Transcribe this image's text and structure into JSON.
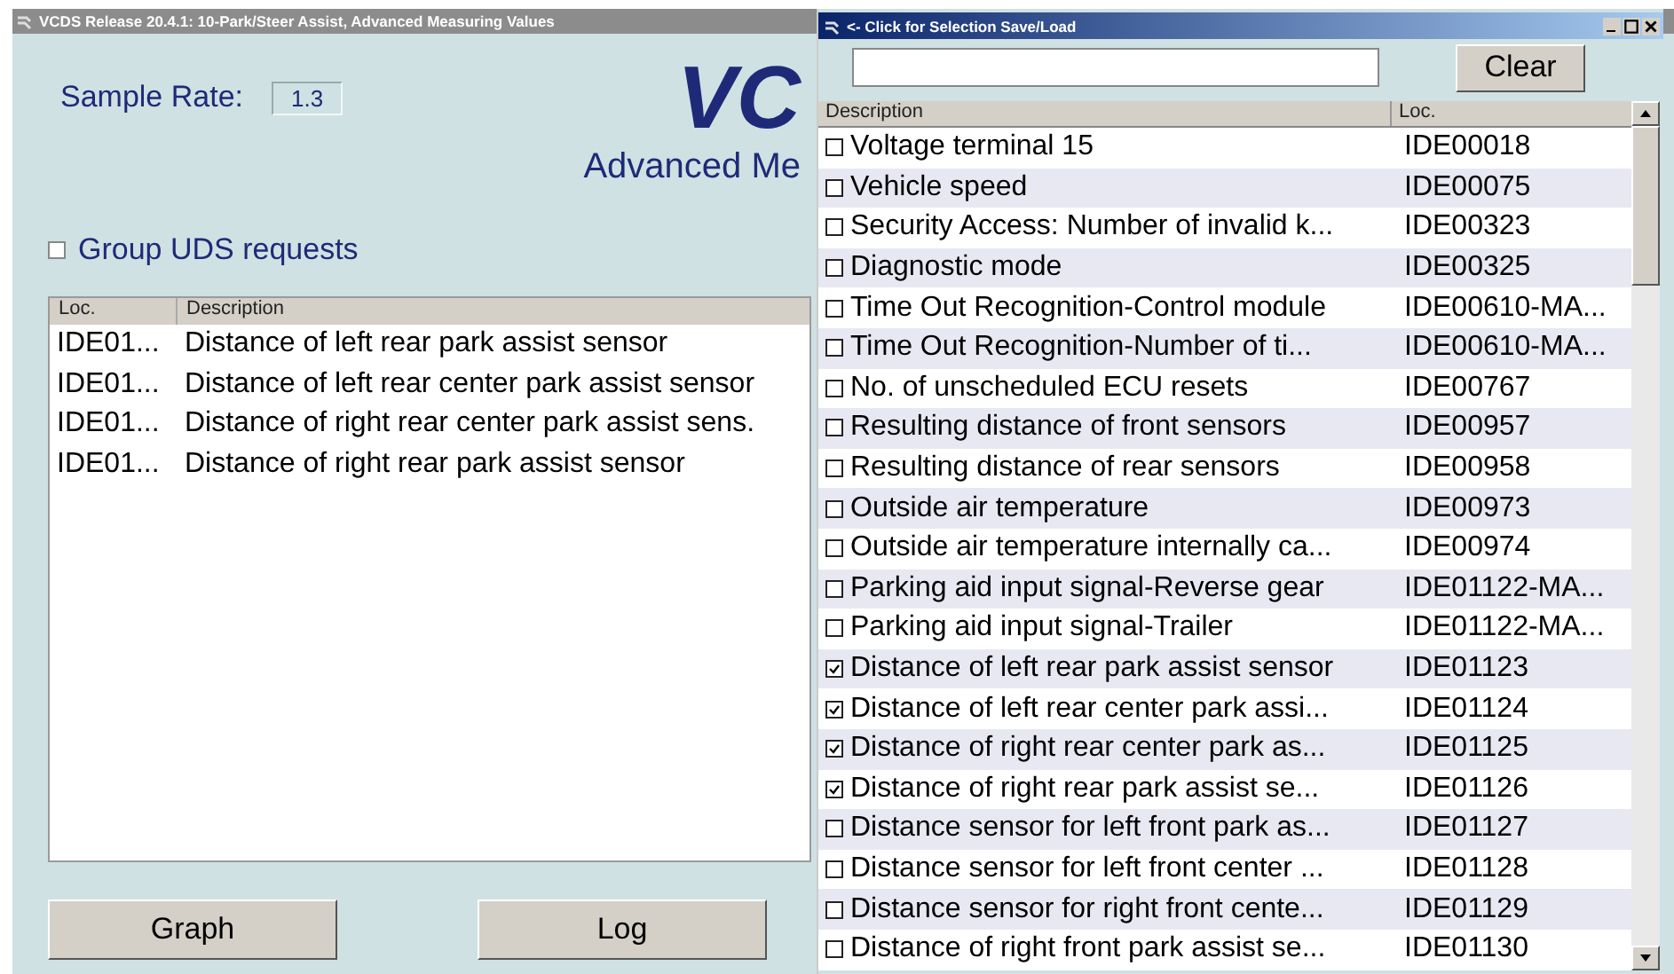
{
  "main_window": {
    "title": "VCDS Release 20.4.1: 10-Park/Steer Assist,  Advanced Measuring Values",
    "sample_rate": {
      "label": "Sample Rate:",
      "value": "1.3"
    },
    "logo": {
      "text": "VC",
      "subtitle": "Advanced Me"
    },
    "group_uds": {
      "label": "Group UDS requests",
      "checked": false
    },
    "list": {
      "columns": [
        "Loc.",
        "Description"
      ],
      "rows": [
        {
          "loc": "IDE01...",
          "description": "Distance of left rear park assist sensor"
        },
        {
          "loc": "IDE01...",
          "description": "Distance of left rear center park assist sensor"
        },
        {
          "loc": "IDE01...",
          "description": "Distance of right rear center park assist sens."
        },
        {
          "loc": "IDE01...",
          "description": "Distance of right rear park assist sensor"
        }
      ]
    },
    "buttons": [
      "Graph",
      "Log"
    ]
  },
  "selection_window": {
    "title": "<- Click for Selection Save/Load",
    "clear_button": "Clear",
    "columns": [
      "Description",
      "Loc."
    ],
    "rows": [
      {
        "description": "Voltage terminal 15",
        "loc": "IDE00018",
        "checked": false
      },
      {
        "description": "Vehicle speed",
        "loc": "IDE00075",
        "checked": false
      },
      {
        "description": "Security Access: Number of invalid k...",
        "loc": "IDE00323",
        "checked": false
      },
      {
        "description": "Diagnostic mode",
        "loc": "IDE00325",
        "checked": false
      },
      {
        "description": "Time Out Recognition-Control module",
        "loc": "IDE00610-MA...",
        "checked": false
      },
      {
        "description": "Time Out Recognition-Number of ti...",
        "loc": "IDE00610-MA...",
        "checked": false
      },
      {
        "description": "No. of unscheduled ECU resets",
        "loc": "IDE00767",
        "checked": false
      },
      {
        "description": "Resulting distance of front sensors",
        "loc": "IDE00957",
        "checked": false
      },
      {
        "description": "Resulting distance of rear sensors",
        "loc": "IDE00958",
        "checked": false
      },
      {
        "description": "Outside air temperature",
        "loc": "IDE00973",
        "checked": false
      },
      {
        "description": "Outside air temperature internally ca...",
        "loc": "IDE00974",
        "checked": false
      },
      {
        "description": "Parking aid input signal-Reverse gear",
        "loc": "IDE01122-MA...",
        "checked": false
      },
      {
        "description": "Parking aid input signal-Trailer",
        "loc": "IDE01122-MA...",
        "checked": false
      },
      {
        "description": "Distance of left rear park assist sensor",
        "loc": "IDE01123",
        "checked": true
      },
      {
        "description": "Distance of left rear center park assi...",
        "loc": "IDE01124",
        "checked": true
      },
      {
        "description": "Distance of right rear center park as...",
        "loc": "IDE01125",
        "checked": true
      },
      {
        "description": "Distance of right rear park assist se...",
        "loc": "IDE01126",
        "checked": true
      },
      {
        "description": "Distance sensor for left front park as...",
        "loc": "IDE01127",
        "checked": false
      },
      {
        "description": "Distance sensor for left front center ...",
        "loc": "IDE01128",
        "checked": false
      },
      {
        "description": "Distance sensor for right front cente...",
        "loc": "IDE01129",
        "checked": false
      },
      {
        "description": "Distance of right front park assist se...",
        "loc": "IDE01130",
        "checked": false
      }
    ]
  }
}
